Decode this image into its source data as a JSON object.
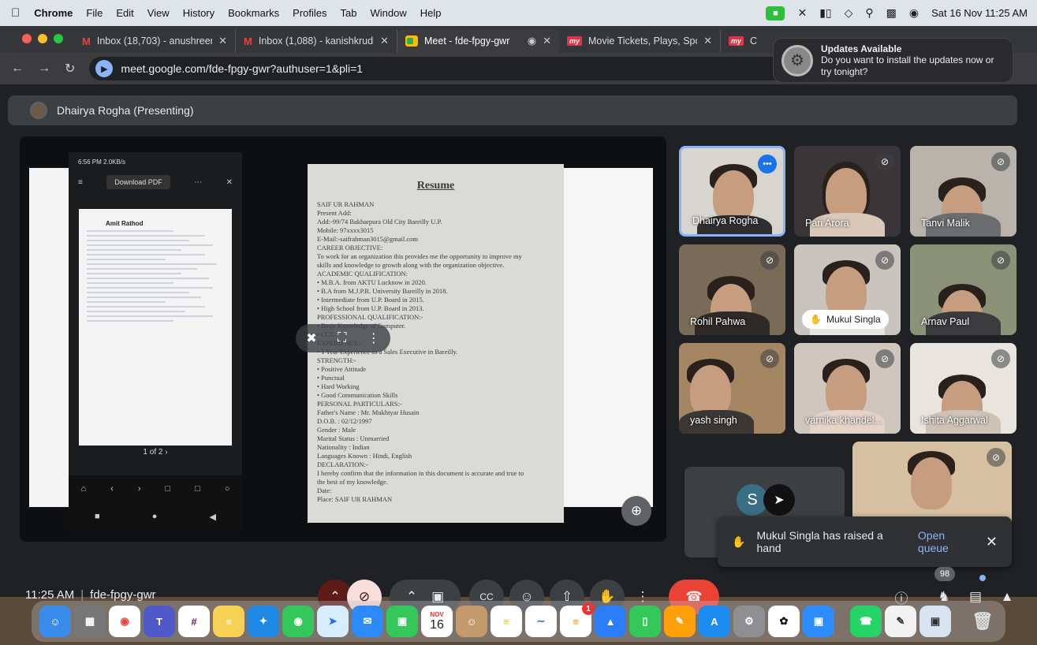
{
  "menubar": {
    "app": "Chrome",
    "items": [
      "File",
      "Edit",
      "View",
      "History",
      "Bookmarks",
      "Profiles",
      "Tab",
      "Window",
      "Help"
    ],
    "datetime": "Sat 16 Nov  11:25 AM"
  },
  "tabs": [
    {
      "title": "Inbox (18,703) - anushreerud",
      "icon": "gmail-icon"
    },
    {
      "title": "Inbox (1,088) - kanishkrudra.",
      "icon": "gmail-icon"
    },
    {
      "title": "Meet - fde-fpgy-gwr",
      "icon": "meet-icon",
      "active": true
    },
    {
      "title": "Movie Tickets, Plays, Sports,",
      "icon": "bookmyshow-icon"
    },
    {
      "title": "C",
      "icon": "bookmyshow-icon"
    }
  ],
  "address": "meet.google.com/fde-fpgy-gwr?authuser=1&pli=1",
  "notification": {
    "title": "Updates Available",
    "body": "Do you want to install the updates now or try tonight?"
  },
  "presenter": {
    "label": "Dhairya Rogha (Presenting)"
  },
  "phone_screen": {
    "status": "6:56 PM  2.0KB/s",
    "download": "Download PDF",
    "doc_name": "Amit Rathod",
    "pager": "1 of 2"
  },
  "resume": {
    "title": "Resume",
    "lines": [
      "SAIF UR RAHMAN",
      "Present Add:",
      "Add:-99/74 Bakharpura Old City Bareilly U.P.",
      "Mobile: 97xxxx3015",
      "E-Mail:-saifrahman3015@gmail.com",
      "CAREER OBJECTIVE:",
      "To work for an organization this provides me the opportunity to improve my",
      "skills and knowledge to growth along with the organization objective.",
      "ACADEMIC QUALIFICATION:",
      "• M.B.A. from AKTU Lucknow in 2020.",
      "• B.A from M.J.P.R. University Bareilly in 2018.",
      "• Intermediate from U.P. Board in 2015.",
      "• High School from U.P. Board in 2013.",
      "PROFESSIONAL QUALIFICATION:-",
      "• Basic Knowledge of Computer.",
      "• CCC",
      "EXPERIENCE:-",
      "• 1 Year Experience as a Sales Executive in Bareilly.",
      "STRENGTH:-",
      "• Positive Attitude",
      "• Punctual",
      "• Hard Working",
      "• Good Communication Skills",
      "PERSONAL PARTICULARS:-",
      "Father's Name          :    Mr. Mukhtyar Husain",
      "D.O.B.                       :    02/12/1997",
      "Gender                      :    Male",
      "Marital Status            :    Unmarried",
      "Nationality                 :    Indian",
      "Languages Known       :    Hindi, English",
      "DECLARATION:-",
      "I hereby confirm that the information in this document is accurate and true to",
      "the best of my knowledge.",
      "Date:",
      "Place:                                                           SAIF UR RAHMAN"
    ]
  },
  "participants": [
    {
      "name": "Dhairya Rogha",
      "speaking": true
    },
    {
      "name": "Pari Arora"
    },
    {
      "name": "Tanvi Malik"
    },
    {
      "name": "Rohil Pahwa"
    },
    {
      "name": "Mukul Singla",
      "hand": true
    },
    {
      "name": "Arnav Paul"
    },
    {
      "name": "yash singh"
    },
    {
      "name": "varnika khandel..."
    },
    {
      "name": "Ishita Aggarwal"
    }
  ],
  "avatar_tile": {
    "initial": "S"
  },
  "toast": {
    "message": "Mukul Singla has raised a hand",
    "action": "Open queue"
  },
  "footer": {
    "time": "11:25 AM",
    "meeting_code": "fde-fpgy-gwr",
    "people_count": "98"
  },
  "dock": {
    "calendar_month": "NOV",
    "calendar_day": "16",
    "reminders_badge": "1"
  }
}
